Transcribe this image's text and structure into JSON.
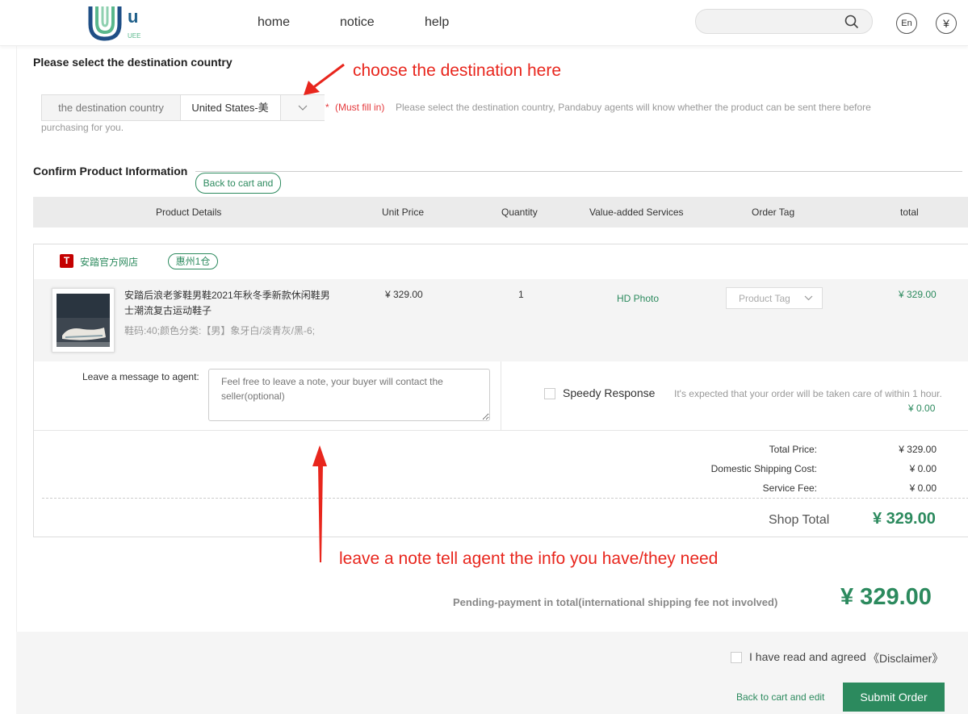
{
  "header": {
    "logo_letter": "u",
    "logo_sub": "UEE",
    "nav": [
      "home",
      "notice",
      "help"
    ],
    "lang_button": "En",
    "currency_button": "¥"
  },
  "destination": {
    "title": "Please select the destination country",
    "label": "the destination country",
    "value": "United States-美",
    "required_mark": "*",
    "required_text": "(Must fill in)",
    "hint_line1": "Please select the destination country, Pandabuy agents will know whether the product can be sent there before",
    "hint_line2": "purchasing for you."
  },
  "confirm": {
    "title": "Confirm Product Information",
    "back_button": "Back to cart and"
  },
  "table_headers": [
    "Product Details",
    "Unit Price",
    "Quantity",
    "Value-added Services",
    "Order Tag",
    "total"
  ],
  "shop": {
    "icon_letter": "T",
    "name": "安踏官方网店",
    "warehouse_tag": "惠州1仓",
    "product": {
      "title_line1": "安踏后浪老爹鞋男鞋2021年秋冬季新款休闲鞋男",
      "title_line2": "士潮流复古运动鞋子",
      "sku": "鞋码:40;颜色分类:【男】象牙白/淡青灰/黑-6;",
      "unit_price": "¥ 329.00",
      "quantity": "1",
      "service": "HD Photo",
      "tag_placeholder": "Product Tag",
      "total": "¥ 329.00"
    },
    "message_label": "Leave a message to agent:",
    "message_placeholder": "Feel free to leave a note, your buyer will contact the seller(optional)",
    "speedy_label": "Speedy Response",
    "speedy_desc": "It's expected that your order will be taken care of within 1 hour.",
    "speedy_price": "¥ 0.00",
    "summary": {
      "total_price_label": "Total Price:",
      "total_price": "¥ 329.00",
      "shipping_label": "Domestic Shipping Cost:",
      "shipping": "¥ 0.00",
      "service_label": "Service Fee:",
      "service": "¥ 0.00",
      "shop_total_label": "Shop Total",
      "shop_total": "¥ 329.00"
    }
  },
  "pending": {
    "label": "Pending-payment in total(international shipping fee not involved)",
    "amount": "¥ 329.00"
  },
  "footer": {
    "agree_text": "I have read and agreed",
    "disclaimer": "《Disclaimer》",
    "back_link": "Back to cart and edit",
    "submit": "Submit Order"
  },
  "annotations": {
    "top": "choose the destination here",
    "bottom": "leave a note tell agent the info you have/they need"
  },
  "colors": {
    "accent_green": "#2c8a5e",
    "annotation_red": "#e8261d",
    "required_red": "#e4393c"
  }
}
